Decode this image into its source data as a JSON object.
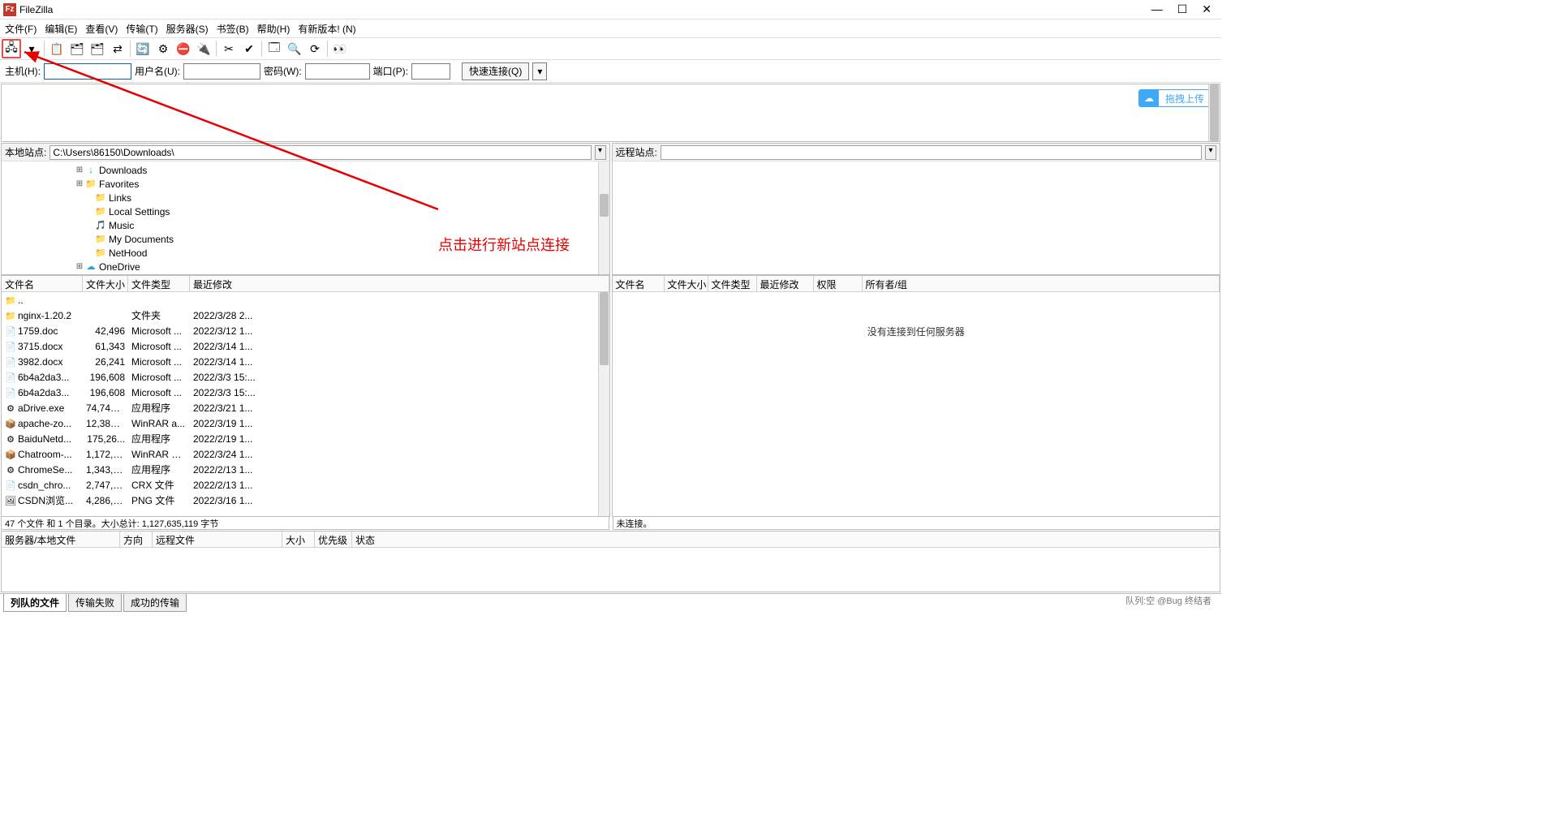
{
  "title": "FileZilla",
  "menu": [
    "文件(F)",
    "编辑(E)",
    "查看(V)",
    "传输(T)",
    "服务器(S)",
    "书签(B)",
    "帮助(H)",
    "有新版本! (N)"
  ],
  "quickconnect": {
    "host_label": "主机(H):",
    "user_label": "用户名(U):",
    "pass_label": "密码(W):",
    "port_label": "端口(P):",
    "button": "快速连接(Q)"
  },
  "upload_button": "拖拽上传",
  "local": {
    "site_label": "本地站点:",
    "path": "C:\\Users\\86150\\Downloads\\",
    "tree": [
      {
        "indent": 90,
        "exp": "⊞",
        "icon": "↓",
        "iconcls": "dl-folder",
        "label": "Downloads"
      },
      {
        "indent": 90,
        "exp": "⊞",
        "icon": "📁",
        "iconcls": "folder",
        "label": "Favorites"
      },
      {
        "indent": 102,
        "exp": "",
        "icon": "📁",
        "iconcls": "folder",
        "label": "Links"
      },
      {
        "indent": 102,
        "exp": "",
        "icon": "📁",
        "iconcls": "folder",
        "label": "Local Settings"
      },
      {
        "indent": 102,
        "exp": "",
        "icon": "🎵",
        "iconcls": "music-icon",
        "label": "Music"
      },
      {
        "indent": 102,
        "exp": "",
        "icon": "📁",
        "iconcls": "folder",
        "label": "My Documents"
      },
      {
        "indent": 102,
        "exp": "",
        "icon": "📁",
        "iconcls": "folder",
        "label": "NetHood"
      },
      {
        "indent": 90,
        "exp": "⊞",
        "icon": "☁",
        "iconcls": "cloud-icon",
        "label": "OneDrive"
      }
    ],
    "cols": [
      "文件名",
      "文件大小",
      "文件类型",
      "最近修改"
    ],
    "files": [
      {
        "icon": "📁",
        "name": "..",
        "size": "",
        "type": "",
        "date": ""
      },
      {
        "icon": "📁",
        "name": "nginx-1.20.2",
        "size": "",
        "type": "文件夹",
        "date": "2022/3/28 2..."
      },
      {
        "icon": "📄",
        "name": "1759.doc",
        "size": "42,496",
        "type": "Microsoft ...",
        "date": "2022/3/12 1..."
      },
      {
        "icon": "📄",
        "name": "3715.docx",
        "size": "61,343",
        "type": "Microsoft ...",
        "date": "2022/3/14 1..."
      },
      {
        "icon": "📄",
        "name": "3982.docx",
        "size": "26,241",
        "type": "Microsoft ...",
        "date": "2022/3/14 1..."
      },
      {
        "icon": "📄",
        "name": "6b4a2da3...",
        "size": "196,608",
        "type": "Microsoft ...",
        "date": "2022/3/3 15:..."
      },
      {
        "icon": "📄",
        "name": "6b4a2da3...",
        "size": "196,608",
        "type": "Microsoft ...",
        "date": "2022/3/3 15:..."
      },
      {
        "icon": "⚙",
        "name": "aDrive.exe",
        "size": "74,747,...",
        "type": "应用程序",
        "date": "2022/3/21 1..."
      },
      {
        "icon": "📦",
        "name": "apache-zo...",
        "size": "12,387,...",
        "type": "WinRAR a...",
        "date": "2022/3/19 1..."
      },
      {
        "icon": "⚙",
        "name": "BaiduNetd...",
        "size": "175,26...",
        "type": "应用程序",
        "date": "2022/2/19 1..."
      },
      {
        "icon": "📦",
        "name": "Chatroom-...",
        "size": "1,172,6...",
        "type": "WinRAR ZI...",
        "date": "2022/3/24 1..."
      },
      {
        "icon": "⚙",
        "name": "ChromeSe...",
        "size": "1,343,3...",
        "type": "应用程序",
        "date": "2022/2/13 1..."
      },
      {
        "icon": "📄",
        "name": "csdn_chro...",
        "size": "2,747,0...",
        "type": "CRX 文件",
        "date": "2022/2/13 1..."
      },
      {
        "icon": "🖼",
        "name": "CSDN浏览...",
        "size": "4,286,2...",
        "type": "PNG 文件",
        "date": "2022/3/16 1..."
      }
    ],
    "status": "47 个文件 和 1 个目录。大小总计: 1,127,635,119 字节"
  },
  "remote": {
    "site_label": "远程站点:",
    "cols": [
      "文件名",
      "文件大小",
      "文件类型",
      "最近修改",
      "权限",
      "所有者/组"
    ],
    "empty_msg": "没有连接到任何服务器",
    "status": "未连接。"
  },
  "queue": {
    "cols": [
      "服务器/本地文件",
      "方向",
      "远程文件",
      "大小",
      "优先级",
      "状态"
    ]
  },
  "tabs": [
    "列队的文件",
    "传输失败",
    "成功的传输"
  ],
  "credit": "队列:空  @Bug 终结者",
  "annotation": "点击进行新站点连接"
}
